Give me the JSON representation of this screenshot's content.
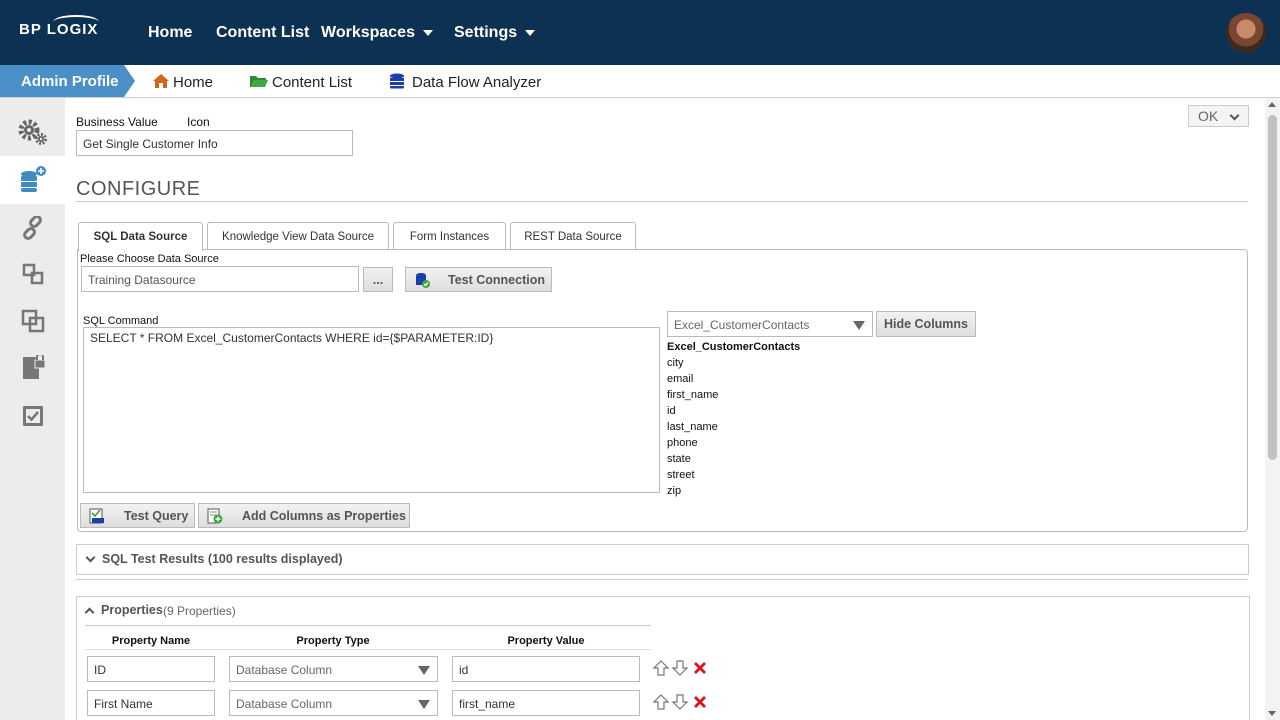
{
  "header": {
    "logo": "BP LOGIX",
    "nav": [
      {
        "label": "Home"
      },
      {
        "label": "Content List"
      },
      {
        "label": "Workspaces"
      },
      {
        "label": "Settings"
      }
    ]
  },
  "breadcrumb": {
    "admin_profile": "Admin Profile",
    "items": [
      {
        "label": "Home",
        "icon": "house-icon"
      },
      {
        "label": "Content List",
        "icon": "folder-open-icon"
      },
      {
        "label": "Data Flow Analyzer",
        "icon": "database-icon"
      }
    ]
  },
  "sidebar": {
    "items": [
      {
        "icon": "gears-icon"
      },
      {
        "icon": "database-add-icon"
      },
      {
        "icon": "link-icon"
      },
      {
        "icon": "flow-icon"
      },
      {
        "icon": "copy-icon"
      },
      {
        "icon": "document-lock-icon"
      },
      {
        "icon": "checklist-icon"
      }
    ]
  },
  "form": {
    "business_value_label": "Business Value",
    "icon_label": "Icon",
    "business_value": "Get Single Customer Info",
    "ok_button": "OK",
    "section_title": "CONFIGURE"
  },
  "tabs": [
    {
      "label": "SQL Data Source"
    },
    {
      "label": "Knowledge View Data Source"
    },
    {
      "label": "Form Instances"
    },
    {
      "label": "REST Data Source"
    }
  ],
  "sql": {
    "datasource_label": "Please Choose Data Source",
    "datasource_value": "Training Datasource",
    "browse_button": "...",
    "test_connection": "Test Connection",
    "command_label": "SQL Command",
    "command_value": "SELECT * FROM Excel_CustomerContacts WHERE id={$PARAMETER:ID}",
    "table_select": "Excel_CustomerContacts",
    "hide_columns": "Hide Columns",
    "table_header": "Excel_CustomerContacts",
    "columns": [
      "city",
      "email",
      "first_name",
      "id",
      "last_name",
      "phone",
      "state",
      "street",
      "zip"
    ],
    "test_query": "Test Query",
    "add_columns": "Add Columns as Properties"
  },
  "results": {
    "title": "SQL Test Results (100 results displayed)"
  },
  "properties": {
    "title": "Properties",
    "count": "(9 Properties)",
    "headers": {
      "name": "Property Name",
      "type": "Property Type",
      "value": "Property Value"
    },
    "rows": [
      {
        "name": "ID",
        "type": "Database Column",
        "value": "id"
      },
      {
        "name": "First Name",
        "type": "Database Column",
        "value": "first_name"
      }
    ]
  },
  "colors": {
    "topbar": "#0d3153",
    "accent": "#4a8fc8",
    "delete": "#d9141b"
  }
}
